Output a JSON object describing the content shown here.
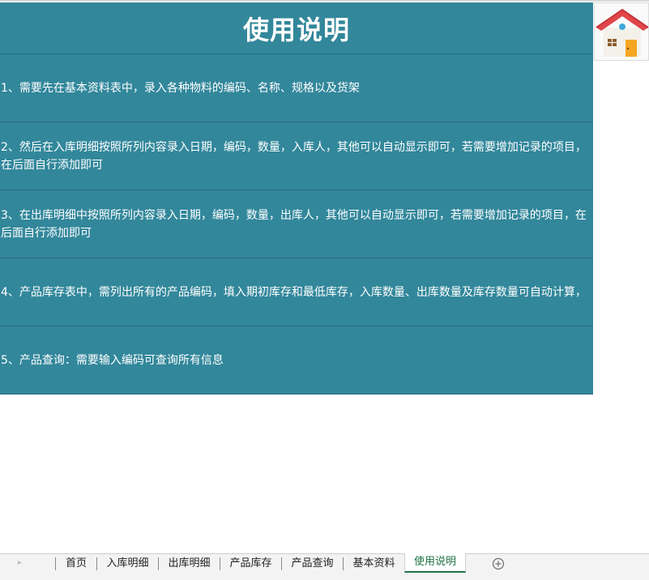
{
  "title": "使用说明",
  "instructions": [
    "1、需要先在基本资料表中，录入各种物料的编码、名称、规格以及货架",
    "2、然后在入库明细按照所列内容录入日期，编码，数量，入库人，其他可以自动显示即可，若需要增加记录的项目，在后面自行添加即可",
    "3、在出库明细中按照所列内容录入日期，编码，数量，出库人，其他可以自动显示即可，若需要增加记录的项目，在后面自行添加即可",
    "4、产品库存表中，需列出所有的产品编码，填入期初库存和最低库存，入库数量、出库数量及库存数量可自动计算，",
    "5、产品查询：需要输入编码可查询所有信息"
  ],
  "home_icon": "house-icon",
  "colors": {
    "header_bg": "#32879b",
    "text": "#ffffff",
    "active_tab": "#217346"
  },
  "tabs": [
    {
      "label": "首页"
    },
    {
      "label": "入库明细"
    },
    {
      "label": "出库明细"
    },
    {
      "label": "产品库存"
    },
    {
      "label": "产品查询"
    },
    {
      "label": "基本资料"
    },
    {
      "label": "使用说明",
      "active": true
    }
  ],
  "add_sheet_icon": "plus-circle-icon"
}
